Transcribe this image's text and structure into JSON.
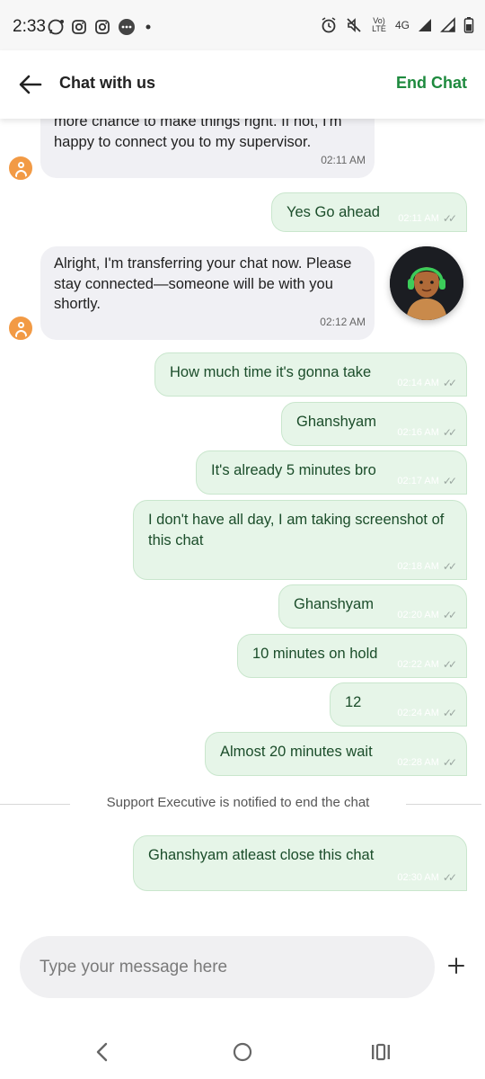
{
  "status_bar": {
    "time": "2:33",
    "network": "Vo) LTE",
    "signal_type": "4G"
  },
  "header": {
    "title": "Chat with us",
    "end_chat_label": "End Chat"
  },
  "messages": [
    {
      "from": "agent",
      "text_lines": [
        "more chance to make things right. If not, I'm",
        "happy to connect you to my supervisor."
      ],
      "time": "02:11 AM"
    },
    {
      "from": "user",
      "text": "Yes Go ahead",
      "time": "02:11 AM"
    },
    {
      "from": "agent",
      "text_lines": [
        "Alright, I'm transferring your chat now. Please",
        "stay connected—someone will be with you",
        "shortly."
      ],
      "time": "02:12 AM"
    },
    {
      "from": "user",
      "text": "How much time it's gonna take",
      "time": "02:14 AM"
    },
    {
      "from": "user",
      "text": "Ghanshyam",
      "time": "02:16 AM"
    },
    {
      "from": "user",
      "text": "It's already 5 minutes bro",
      "time": "02:17 AM"
    },
    {
      "from": "user",
      "text_lines": [
        "I don't have all day, I am taking screenshot of",
        "this chat"
      ],
      "time": "02:18 AM"
    },
    {
      "from": "user",
      "text": "Ghanshyam",
      "time": "02:20 AM"
    },
    {
      "from": "user",
      "text": "10 minutes on hold",
      "time": "02:22 AM"
    },
    {
      "from": "user",
      "text": "12",
      "time": "02:24 AM"
    },
    {
      "from": "user",
      "text": "Almost 20 minutes wait",
      "time": "02:28 AM"
    },
    {
      "from": "user",
      "text": "Ghanshyam atleast close this chat",
      "time": "02:30 AM"
    }
  ],
  "system_notice": "Support Executive is notified to end the chat",
  "composer": {
    "placeholder": "Type your message here",
    "add_icon": "plus-icon"
  },
  "colors": {
    "accent_green": "#1e8a3e",
    "user_bubble": "#e6f5e8",
    "agent_bubble": "#f0f0f4",
    "avatar_orange": "#f29a45"
  }
}
